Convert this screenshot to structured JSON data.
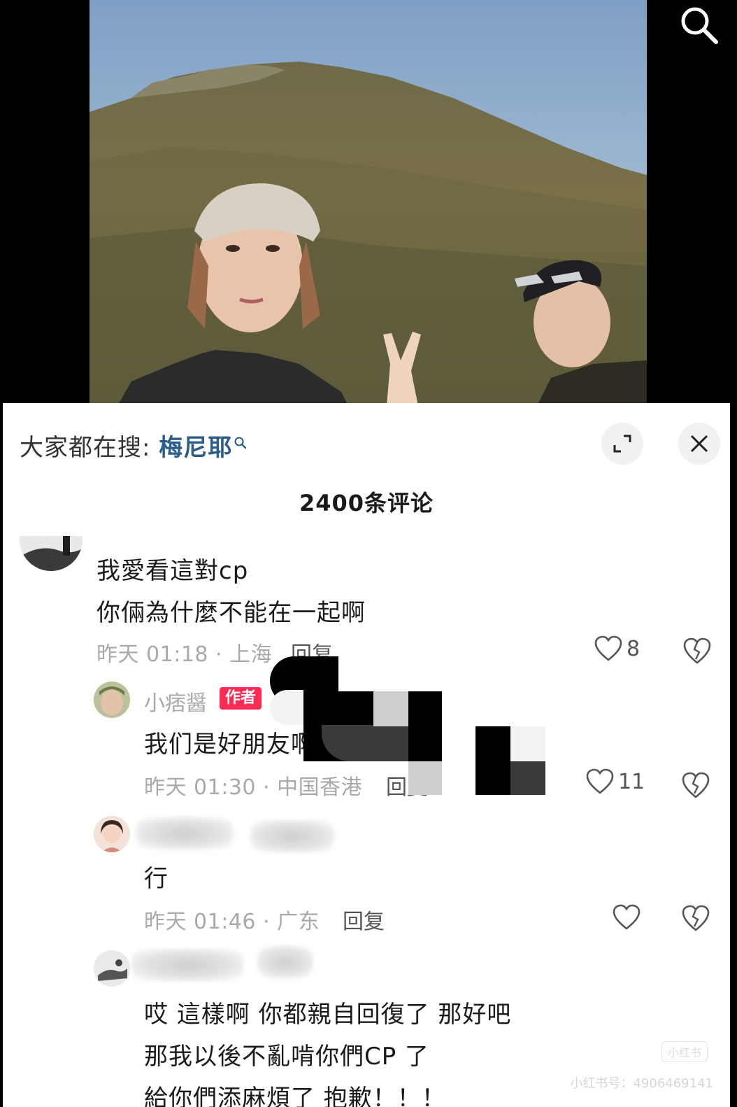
{
  "hot_search": {
    "label": "大家都在搜: ",
    "keyword": "梅尼耶"
  },
  "comments_header": {
    "count_label": "2400条评论"
  },
  "comments": [
    {
      "lines": [
        "我愛看這對cp",
        "你倆為什麼不能在一起啊"
      ],
      "meta": "昨天 01:18 · 上海",
      "reply_label": "回复",
      "likes": "8"
    },
    {
      "username": "小痞醤",
      "badge": "作者",
      "lines": [
        "我们是好朋友啊"
      ],
      "meta": "昨天 01:30 · 中国香港",
      "reply_label": "回复",
      "likes": "11"
    },
    {
      "lines": [
        "行"
      ],
      "meta": "昨天 01:46 · 广东",
      "reply_label": "回复",
      "likes": ""
    },
    {
      "lines": [
        "哎 這樣啊 你都親自回復了 那好吧",
        "那我以後不亂啃你們CP 了",
        "給你們添麻煩了 抱歉！！！"
      ]
    }
  ],
  "watermark": {
    "logo": "小红书",
    "text": "小红书号：4906469141"
  },
  "colors": {
    "accent": "#fe2c55",
    "keyword": "#2b5d8c",
    "meta_gray": "#a9a9a9"
  },
  "icons": [
    "search-icon",
    "expand-icon",
    "close-icon",
    "heart-icon",
    "broken-heart-icon"
  ]
}
